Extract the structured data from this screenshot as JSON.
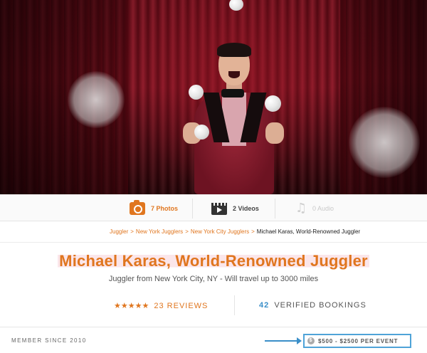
{
  "hero": {
    "alt_subject": "juggler"
  },
  "media": {
    "photos_label": "7 Photos",
    "videos_label": "2 Videos",
    "audio_label": "0 Audio"
  },
  "breadcrumb": {
    "items": [
      "Juggler",
      "New York Jugglers",
      "New York City Jugglers"
    ],
    "separator": ">",
    "current": "Michael Karas, World-Renowned Juggler"
  },
  "profile": {
    "title": "Michael Karas, World-Renowned Juggler",
    "subtitle": "Juggler from New York City, NY - Will travel up to 3000 miles",
    "stars": "★★★★★",
    "reviews_label": "23 REVIEWS",
    "bookings_count": "42",
    "bookings_label": "VERIFIED BOOKINGS"
  },
  "footer": {
    "member_since": "MEMBER SINCE 2010",
    "price_icon": "$",
    "price_range": "$500 - $2500 PER EVENT"
  },
  "colors": {
    "accent": "#e0761f",
    "link_blue": "#3a8fc9",
    "curtain": "#7a0c1a"
  }
}
